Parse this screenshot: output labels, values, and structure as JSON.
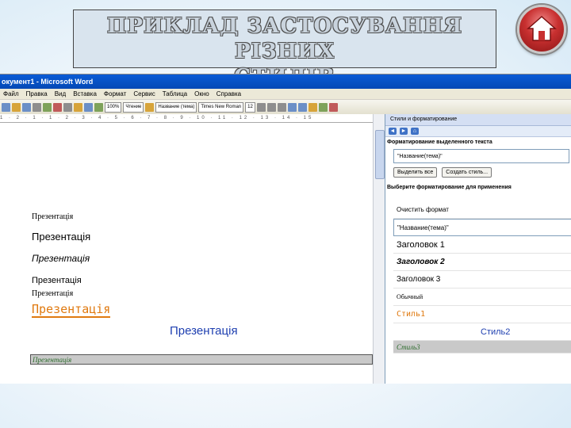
{
  "slide": {
    "title_line1": "ПРИКЛАД ЗАСТОСУВАННЯ РІЗНИХ",
    "title_line2": "СТИЛІВ"
  },
  "word": {
    "window_title": "окумент1 - Microsoft Word",
    "menu": [
      "Файл",
      "Правка",
      "Вид",
      "Вставка",
      "Формат",
      "Сервис",
      "Таблица",
      "Окно",
      "Справка"
    ],
    "toolbar": {
      "zoom": "100%",
      "view_label": "Чтение",
      "style_box": "Название (тема)",
      "font_box": "Times New Roman",
      "size_box": "12"
    },
    "ruler_text": "1 · 2 · 1 · 1 · 2 · 3 · 4 · 5 · 6 · 7 · 8 · 9 · 10 · 11 · 12 · 13 · 14 · 15",
    "document_lines": [
      "Презентація",
      "Презентація",
      "Презентація",
      "Презентація",
      "Презентація",
      "Презентація",
      "Презентація",
      "Презентація"
    ],
    "task_pane": {
      "title": "Стили и форматирование",
      "section_selected": "Форматирование выделенного текста",
      "selected_value": "\"Название(тема)\"",
      "btn_select_all": "Выделить все",
      "btn_new_style": "Создать стиль...",
      "section_apply": "Выберите форматирование для применения",
      "styles": [
        "Очистить формат",
        "\"Название(тема)\"",
        "Заголовок 1",
        "Заголовок 2",
        "Заголовок 3",
        "Обычный",
        "Стиль1",
        "Стиль2",
        "Стиль3"
      ]
    }
  },
  "colors": {
    "title_bar": "#0348b5",
    "home_red": "#c83030",
    "style1_orange": "#e07a10",
    "style2_blue": "#1e3fb0"
  }
}
